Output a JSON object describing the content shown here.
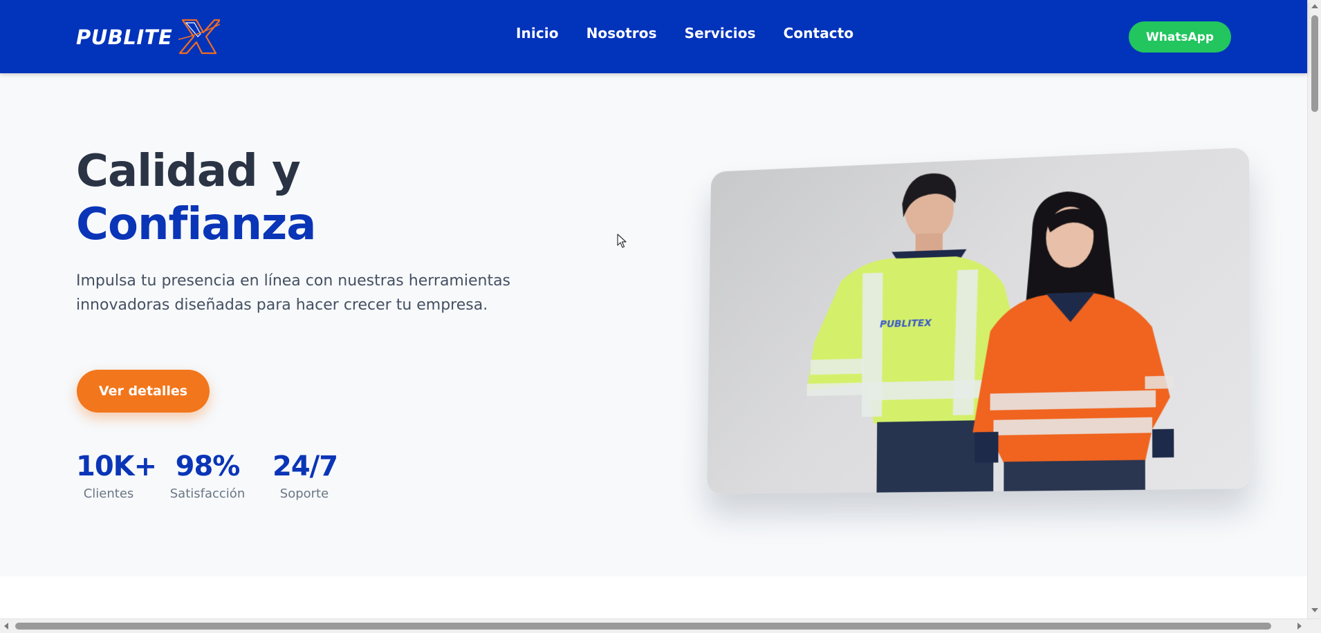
{
  "brand": {
    "logo_text": "PUBLITE",
    "logo_x": "X",
    "colors": {
      "nav": "#0233bb",
      "accent": "#0a35b7",
      "cta": "#f2761b",
      "whatsapp": "#22c55e"
    }
  },
  "nav": {
    "items": [
      {
        "label": "Inicio"
      },
      {
        "label": "Nosotros"
      },
      {
        "label": "Servicios"
      },
      {
        "label": "Contacto"
      }
    ],
    "whatsapp_label": "WhatsApp"
  },
  "hero": {
    "title_line1": "Calidad y",
    "title_line2": "Confianza",
    "subtitle": "Impulsa tu presencia en línea con nuestras herramientas innovadoras diseñadas para hacer crecer tu empresa.",
    "cta_label": "Ver detalles",
    "stats": [
      {
        "value": "10K+",
        "label": "Clientes"
      },
      {
        "value": "98%",
        "label": "Satisfacción"
      },
      {
        "value": "24/7",
        "label": "Soporte"
      }
    ],
    "image_logo_text": "PUBLITEX"
  },
  "icons": {
    "cursor": "arrow-cursor-icon"
  }
}
